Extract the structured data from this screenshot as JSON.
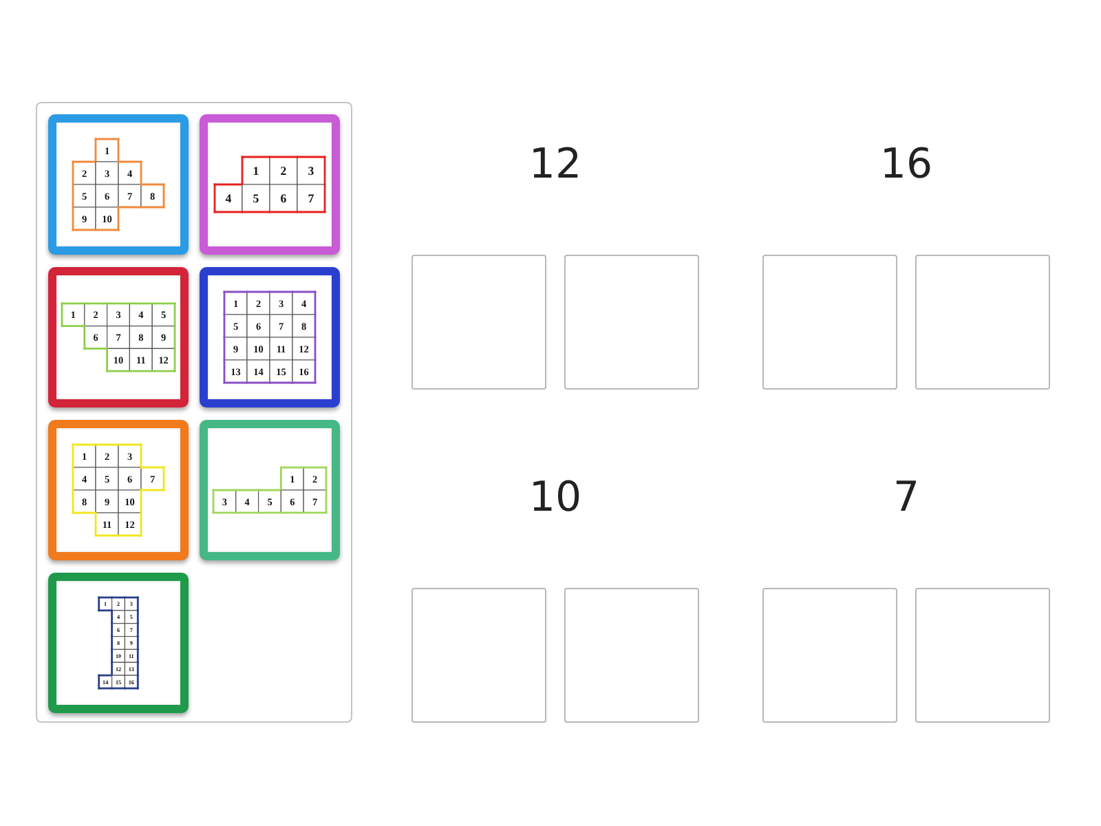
{
  "cards": [
    {
      "color": "#2a9be4",
      "grid": {
        "color": "#f08a3c",
        "rows": [
          [
            null,
            "1",
            null,
            null
          ],
          [
            "2",
            "3",
            "4",
            null
          ],
          [
            "5",
            "6",
            "7",
            "8"
          ],
          [
            "9",
            "10",
            null,
            null
          ]
        ]
      }
    },
    {
      "color": "#c95bd6",
      "grid": {
        "color": "#e8201e",
        "rows": [
          [
            null,
            "1",
            "2",
            "3"
          ],
          [
            "4",
            "5",
            "6",
            "7"
          ]
        ]
      }
    },
    {
      "color": "#d3243a",
      "grid": {
        "color": "#8fce4a",
        "rows": [
          [
            "1",
            "2",
            "3",
            "4",
            "5"
          ],
          [
            null,
            "6",
            "7",
            "8",
            "9"
          ],
          [
            null,
            null,
            "10",
            "11",
            "12"
          ]
        ]
      }
    },
    {
      "color": "#2a3fcf",
      "grid": {
        "color": "#8a4fc6",
        "rows": [
          [
            "1",
            "2",
            "3",
            "4"
          ],
          [
            "5",
            "6",
            "7",
            "8"
          ],
          [
            "9",
            "10",
            "11",
            "12"
          ],
          [
            "13",
            "14",
            "15",
            "16"
          ]
        ]
      }
    },
    {
      "color": "#f07a1c",
      "grid": {
        "color": "#f2e61e",
        "rows": [
          [
            "1",
            "2",
            "3",
            null
          ],
          [
            "4",
            "5",
            "6",
            "7"
          ],
          [
            "8",
            "9",
            "10",
            null
          ],
          [
            null,
            "11",
            "12",
            null
          ]
        ]
      }
    },
    {
      "color": "#45b885",
      "grid": {
        "color": "#9fd65a",
        "rows": [
          [
            null,
            null,
            null,
            "1",
            "2"
          ],
          [
            "3",
            "4",
            "5",
            "6",
            "7"
          ]
        ]
      }
    },
    {
      "color": "#1f9a4b",
      "grid": {
        "color": "#2a3f8a",
        "rows": [
          [
            "1",
            "2",
            "3"
          ],
          [
            null,
            "4",
            "5"
          ],
          [
            null,
            "6",
            "7"
          ],
          [
            null,
            "8",
            "9"
          ],
          [
            null,
            "10",
            "11"
          ],
          [
            null,
            "12",
            "13"
          ],
          [
            "14",
            "15",
            "16"
          ]
        ]
      }
    }
  ],
  "groups": [
    {
      "title": "12"
    },
    {
      "title": "16"
    },
    {
      "title": "10"
    },
    {
      "title": "7"
    }
  ]
}
